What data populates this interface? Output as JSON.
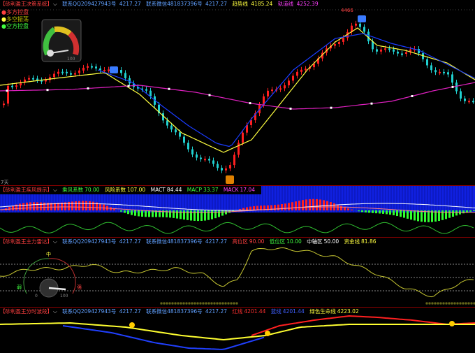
{
  "panel1": {
    "title": "【砂利盈王决策系统】",
    "contact_qq": "联系QQ209427943号",
    "price": "4217.27",
    "contact_wx": "联系微信481837396号",
    "price2": "4217.27",
    "trend_label": "趋势线",
    "trend_value": "4185.24",
    "track_label": "轨道线",
    "track_value": "4252.39",
    "legend": [
      "多方控盘",
      "多空振荡",
      "空方控盘"
    ],
    "high_label": "4466",
    "low_label": "7天",
    "gauge_value": "100",
    "colors": {
      "bull": "#ff2020",
      "bear": "#20d0d0",
      "trend": "#ffff40",
      "track": "#e020c0",
      "blue_ma": "#1a3cff"
    }
  },
  "panel2": {
    "title": "【砂利盈王疾风提示】",
    "items": [
      {
        "label": "乘风系数",
        "value": "70.00",
        "color": "#40ff40"
      },
      {
        "label": "风险系数",
        "value": "107.00",
        "color": "#ffff40"
      },
      {
        "label": "MACT",
        "value": "84.44",
        "color": "#ffffff"
      },
      {
        "label": "MACP",
        "value": "33.37",
        "color": "#40ff40"
      },
      {
        "label": "MACK",
        "value": "17.04",
        "color": "#ff40ff"
      }
    ]
  },
  "panel3": {
    "title": "【砂利盈王主力雷达】",
    "contact_qq": "联系QQ209427943号",
    "price": "4217.27",
    "contact_wx": "联系微信481837396号",
    "price2": "4217.27",
    "items": [
      {
        "label": "高位区",
        "value": "90.00",
        "color": "#ff4040"
      },
      {
        "label": "低位区",
        "value": "10.00",
        "color": "#40ff40"
      },
      {
        "label": "中轴区",
        "value": "50.00",
        "color": "#ffffff"
      },
      {
        "label": "资金线",
        "value": "81.86",
        "color": "#ffff40"
      }
    ],
    "gauge_labels": {
      "mid": "中",
      "low": "弱",
      "high": "强",
      "zero": "0",
      "hundred": "100"
    }
  },
  "panel4": {
    "title": "【砂利盈王分时波段】",
    "contact_qq": "联系QQ209427943号",
    "price": "4217.27",
    "contact_wx": "联系微信481837396号",
    "price2": "4217.27",
    "items": [
      {
        "label": "红线",
        "value": "4201.44",
        "color": "#ff3030"
      },
      {
        "label": "蓝线",
        "value": "4201.44",
        "color": "#4060ff"
      },
      {
        "label": "绿色生命线",
        "value": "4223.02",
        "color": "#ffff40"
      }
    ]
  }
}
